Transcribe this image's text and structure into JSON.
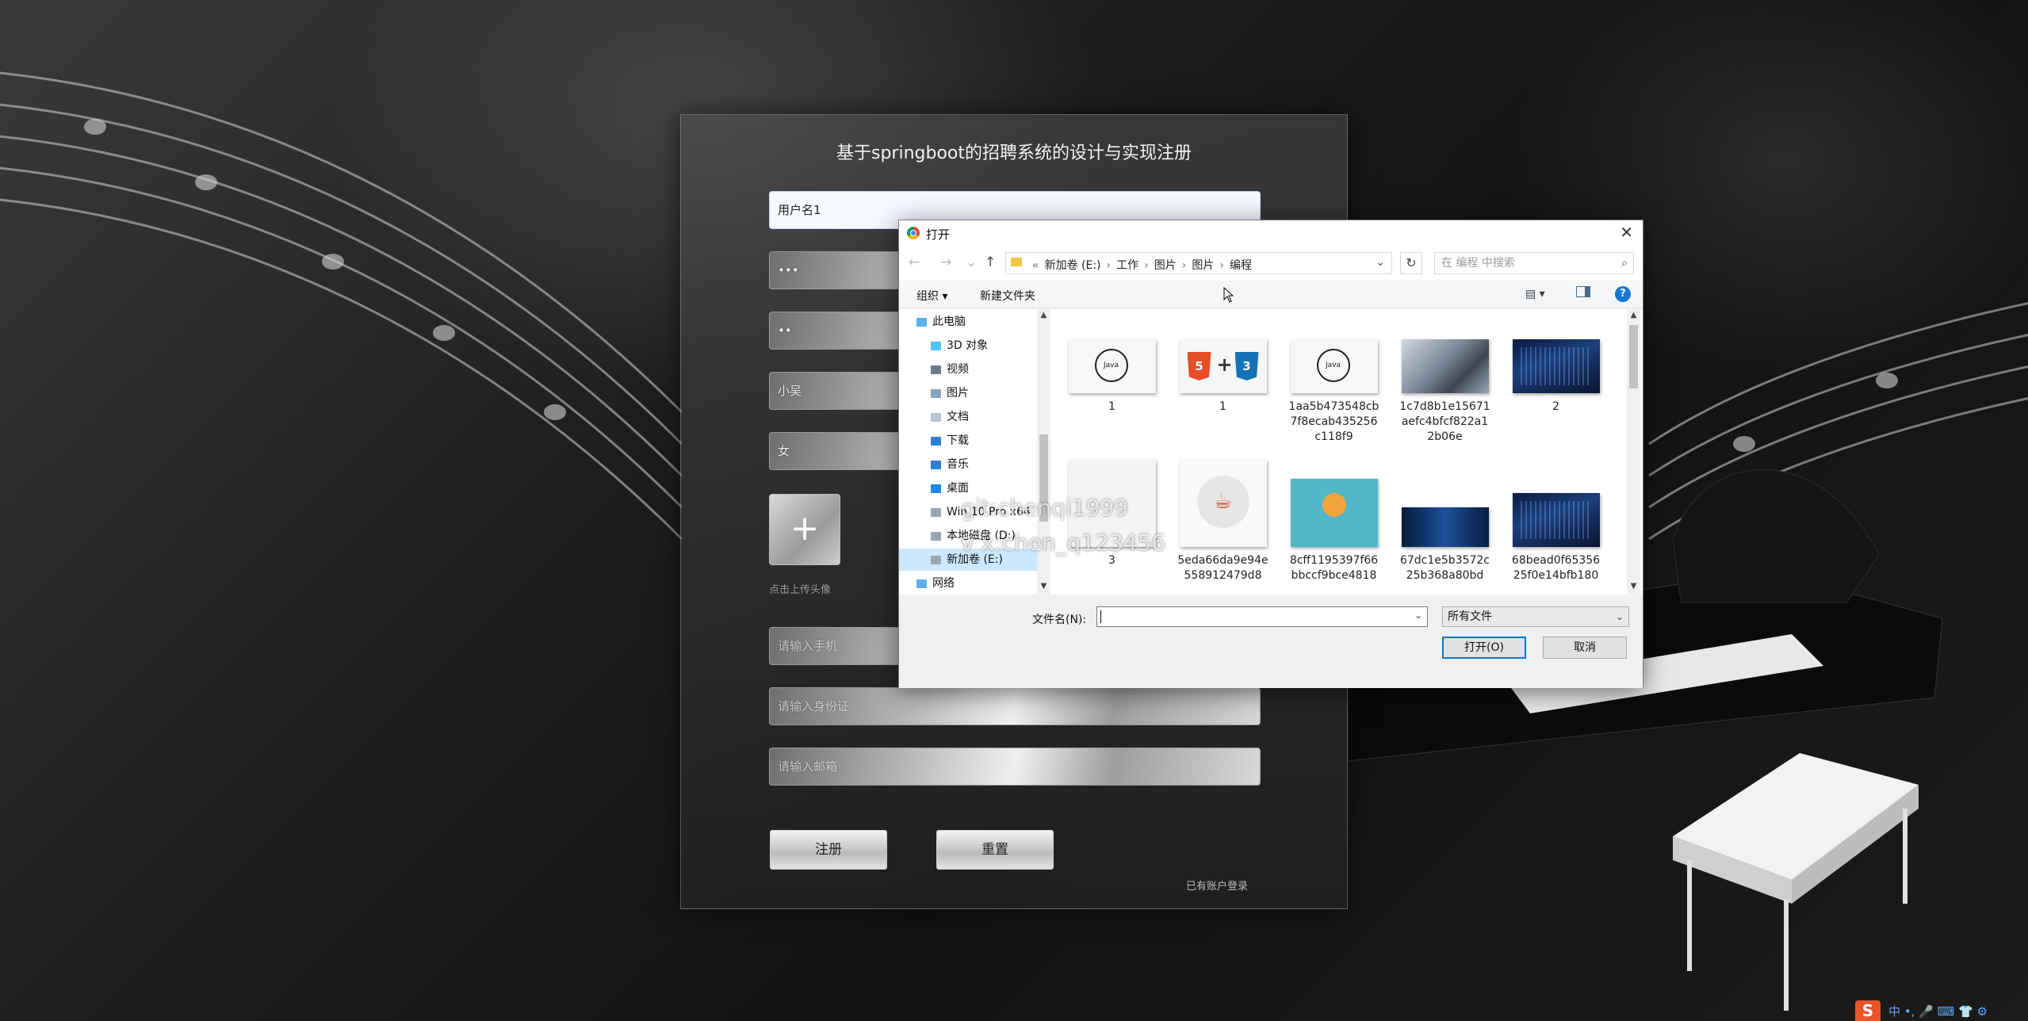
{
  "register": {
    "title": "基于springboot的招聘系统的设计与实现注册",
    "username_value": "用户名1",
    "password_value": "•••",
    "confirm_password_value": "••",
    "name_value": "小吴",
    "gender_value": "女",
    "upload_plus": "+",
    "upload_hint": "点击上传头像",
    "phone_placeholder": "请输入手机",
    "idcard_placeholder": "请输入身份证",
    "email_placeholder": "请输入邮箱",
    "register_button": "注册",
    "reset_button": "重置",
    "login_link": "已有账户登录"
  },
  "dialog": {
    "title": "打开",
    "close": "✕",
    "breadcrumb": [
      "新加卷 (E:)",
      "工作",
      "图片",
      "图片",
      "编程"
    ],
    "search_placeholder": "在 编程 中搜索",
    "toolbar": {
      "organize": "组织 ▾",
      "new_folder": "新建文件夹"
    },
    "nav_items": [
      {
        "label": "此电脑",
        "icon": "computer-icon"
      },
      {
        "label": "3D 对象",
        "icon": "3d-objects-icon"
      },
      {
        "label": "视频",
        "icon": "video-icon"
      },
      {
        "label": "图片",
        "icon": "pictures-icon"
      },
      {
        "label": "文档",
        "icon": "documents-icon"
      },
      {
        "label": "下载",
        "icon": "download-icon"
      },
      {
        "label": "音乐",
        "icon": "music-icon"
      },
      {
        "label": "桌面",
        "icon": "desktop-icon"
      },
      {
        "label": "Win 10 Pro x64",
        "icon": "drive-icon"
      },
      {
        "label": "本地磁盘 (D:)",
        "icon": "drive-icon"
      },
      {
        "label": "新加卷 (E:)",
        "icon": "drive-icon",
        "selected": true
      },
      {
        "label": "网络",
        "icon": "network-icon"
      }
    ],
    "files": [
      {
        "label": "1",
        "thumb": "java-logo"
      },
      {
        "label": "1",
        "thumb": "html5-css3"
      },
      {
        "label": "1aa5b473548cb7f8ecab435256c118f9",
        "thumb": "java-logo"
      },
      {
        "label": "1c7d8b1e15671aefc4bfcf822a12b06e",
        "thumb": "laptop-photo"
      },
      {
        "label": "2",
        "thumb": "blue-code"
      },
      {
        "label": "3",
        "thumb": "desk-illustration"
      },
      {
        "label": "5eda66da9e94e558912479d8",
        "thumb": "java-cup"
      },
      {
        "label": "8cff1195397f66bbccf9bce4818",
        "thumb": "teal-illustration"
      },
      {
        "label": "67dc1e5b3572c25b368a80bd",
        "thumb": "blue-tech"
      },
      {
        "label": "68bead0f6535625f0e14bfb180",
        "thumb": "blue-code"
      }
    ],
    "filename_label": "文件名(N):",
    "filename_value": "",
    "filetype_value": "所有文件",
    "open_button": "打开(O)",
    "cancel_button": "取消"
  },
  "watermark": {
    "line1": "git:chenqi1999",
    "line2": "v x:chen_q123456"
  },
  "tray": {
    "ime_logo": "S",
    "status": "中 •, 🎤 ⌨ 👕 ⚙"
  },
  "colors": {
    "accent": "#0078d7",
    "nav_selected": "#cce8ff",
    "ime": "#e8552b"
  }
}
